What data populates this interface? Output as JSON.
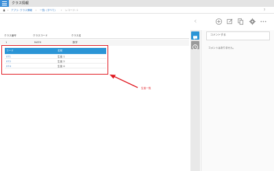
{
  "app": {
    "title": "クラス情報"
  },
  "breadcrumb": {
    "items": [
      "アプリ: クラス情報",
      "一覧: (すべて)",
      "レコード: 1"
    ]
  },
  "main_table": {
    "headers": [
      "クラス番号",
      "クラスコード",
      "クラス名"
    ],
    "row": [
      "1",
      "MATH",
      "数学"
    ]
  },
  "subtable": {
    "headers": [
      "コード",
      "名前"
    ],
    "rows": [
      {
        "code": "071",
        "name": "生徒 1"
      },
      {
        "code": "072",
        "name": "生徒 2"
      },
      {
        "code": "074",
        "name": "生徒 4"
      }
    ]
  },
  "annotation": {
    "label": "生徒一覧",
    "color": "#e0171f"
  },
  "sidebar": {
    "comment_placeholder": "コメントする",
    "no_comments": "コメントはありません。"
  },
  "colors": {
    "accent": "#2b95d6",
    "link": "#2f7ac9"
  }
}
